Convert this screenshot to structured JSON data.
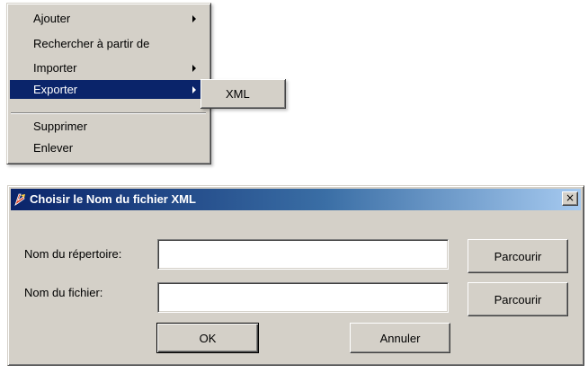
{
  "context_menu": {
    "items": [
      {
        "label": "Ajouter",
        "has_submenu": true
      },
      {
        "label": "Rechercher à partir de",
        "has_submenu": false
      },
      {
        "label": "Importer",
        "has_submenu": true
      },
      {
        "label": "Exporter",
        "has_submenu": true,
        "highlighted": true
      },
      {
        "label": "Supprimer",
        "has_submenu": false
      },
      {
        "label": "Enlever",
        "has_submenu": false
      }
    ]
  },
  "submenu": {
    "items": [
      {
        "label": "XML"
      }
    ]
  },
  "dialog": {
    "title": "Choisir le Nom du fichier XML",
    "close_symbol": "×",
    "fields": [
      {
        "label": "Nom du répertoire:",
        "value": "",
        "browse_label": "Parcourir"
      },
      {
        "label": "Nom du fichier:",
        "value": "",
        "browse_label": "Parcourir"
      }
    ],
    "ok_label": "OK",
    "cancel_label": "Annuler"
  },
  "colors": {
    "face": "#d4d0c8",
    "highlight": "#0a246a",
    "title_gradient_start": "#0a246a",
    "title_gradient_end": "#a6caf0"
  }
}
